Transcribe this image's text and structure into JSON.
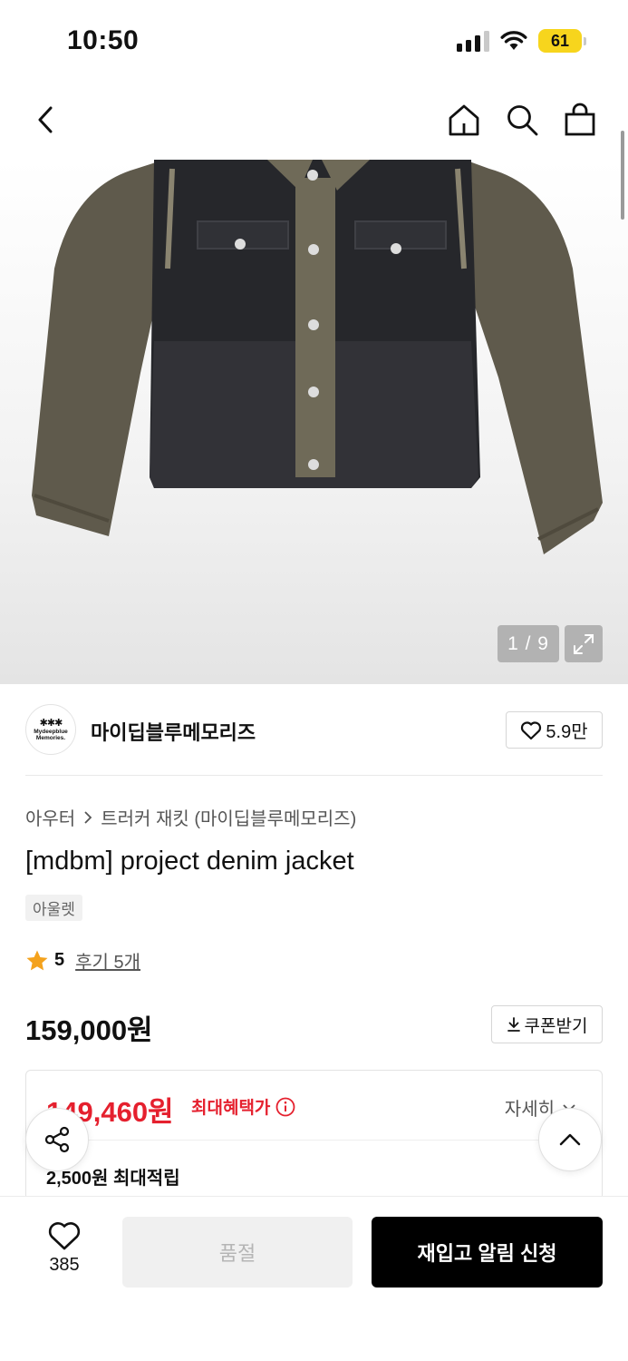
{
  "status_bar": {
    "time": "10:50",
    "battery": "61"
  },
  "product": {
    "image_counter": "1 / 9",
    "brand": {
      "name": "마이딥블루메모리즈",
      "logo_stars": "✱✱✱",
      "logo_text": "Mydeepblue Memories.",
      "likes": "5.9만"
    },
    "breadcrumb": {
      "category": "아우터",
      "subcategory": "트러커 재킷 (마이딥블루메모리즈)"
    },
    "title": "[mdbm] project denim jacket",
    "tag": "아울렛",
    "rating": {
      "score": "5",
      "reviews": "후기 5개",
      "star_color": "#f4a21d"
    },
    "price": "159,000원",
    "coupon_label": "쿠폰받기",
    "benefit": {
      "max_price": "149,460원",
      "max_label": "최대혜택가",
      "detail_label": "자세히",
      "points": "2,500원 최대적립",
      "accent_color": "#e5202e"
    }
  },
  "bottom_bar": {
    "wish_count": "385",
    "soldout_label": "품절",
    "notify_label": "재입고 알림 신청"
  }
}
